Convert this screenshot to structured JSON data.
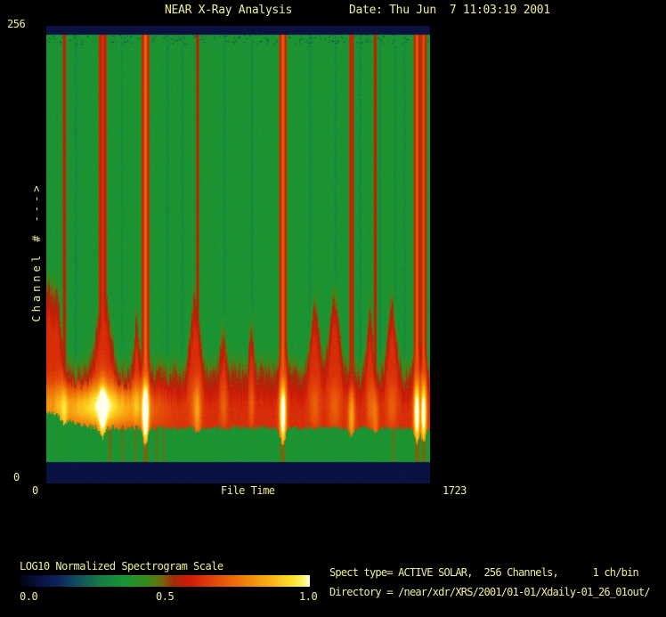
{
  "window": {
    "bg": "#000000",
    "text_color": "#f0ee9c"
  },
  "header": {
    "title": "NEAR X-Ray Analysis",
    "date": "Date: Thu Jun  7 11:03:19 2001"
  },
  "axes": {
    "y_label": "Channel # --->",
    "y_max": "256",
    "y_min": "0",
    "x_label": "File Time",
    "x_min": "0",
    "x_max": "1723"
  },
  "colorbar": {
    "label": "LOG10 Normalized Spectrogram Scale",
    "ticks": [
      "0.0",
      "0.5",
      "1.0"
    ]
  },
  "info": {
    "spect_line": "Spect type= ACTIVE SOLAR,  256 Channels,      1 ch/bin",
    "directory_line": "Directory = /near/xdr/XRS/2001/01-01/Xdaily-01_26_01out/"
  },
  "chart_data": {
    "type": "heatmap",
    "title": "NEAR X-Ray Analysis",
    "xlabel": "File Time",
    "ylabel": "Channel #",
    "x_range": [
      0,
      1723
    ],
    "y_range": [
      0,
      256
    ],
    "channels": 256,
    "ch_per_bin": 1,
    "spect_type": "ACTIVE SOLAR",
    "scale": {
      "label": "LOG10 Normalized Spectrogram Scale",
      "range": [
        0.0,
        1.0
      ],
      "ticks": [
        0.0,
        0.5,
        1.0
      ]
    },
    "colormap_stops": [
      [
        0.0,
        [
          2,
          2,
          18
        ]
      ],
      [
        0.07,
        [
          10,
          18,
          66
        ]
      ],
      [
        0.13,
        [
          14,
          36,
          92
        ]
      ],
      [
        0.2,
        [
          18,
          80,
          95
        ]
      ],
      [
        0.28,
        [
          22,
          125,
          70
        ]
      ],
      [
        0.36,
        [
          24,
          150,
          52
        ]
      ],
      [
        0.44,
        [
          55,
          140,
          30
        ]
      ],
      [
        0.49,
        [
          115,
          105,
          12
        ]
      ],
      [
        0.53,
        [
          160,
          45,
          10
        ]
      ],
      [
        0.58,
        [
          205,
          25,
          8
        ]
      ],
      [
        0.66,
        [
          225,
          65,
          8
        ]
      ],
      [
        0.76,
        [
          240,
          120,
          10
        ]
      ],
      [
        0.86,
        [
          250,
          175,
          20
        ]
      ],
      [
        0.94,
        [
          255,
          225,
          45
        ]
      ],
      [
        0.985,
        [
          255,
          248,
          120
        ]
      ],
      [
        1.0,
        [
          255,
          255,
          235
        ]
      ]
    ],
    "background_value": 0.368,
    "navy_value": 0.07,
    "bands": {
      "top_navy_from_channel": 251.5,
      "bottom_navy_to_channel": 11.5,
      "lower_green_top_channel": 31,
      "left_rise": {
        "amp": 8,
        "sigma": 0.05
      }
    },
    "flame": {
      "base_channel": 56,
      "fade_channels": 20,
      "core": {
        "center_channel": 43,
        "sigma": 9,
        "streak_center_channel": 38,
        "streak_sigma": 13,
        "left_zone": {
          "center_t": 0.14,
          "sigma": 0.09,
          "amp": 0.32
        }
      },
      "peaks": [
        {
          "t": 0.002,
          "h": 46,
          "w": 0.012
        },
        {
          "t": 0.028,
          "h": 38,
          "w": 0.01
        },
        {
          "t": 0.148,
          "h": 46,
          "w": 0.016
        },
        {
          "t": 0.235,
          "h": 28,
          "w": 0.006
        },
        {
          "t": 0.258,
          "h": 52,
          "w": 0.005
        },
        {
          "t": 0.388,
          "h": 42,
          "w": 0.011
        },
        {
          "t": 0.462,
          "h": 24,
          "w": 0.007
        },
        {
          "t": 0.535,
          "h": 28,
          "w": 0.005
        },
        {
          "t": 0.617,
          "h": 50,
          "w": 0.006
        },
        {
          "t": 0.7,
          "h": 40,
          "w": 0.01
        },
        {
          "t": 0.752,
          "h": 42,
          "w": 0.012
        },
        {
          "t": 0.844,
          "h": 36,
          "w": 0.006
        },
        {
          "t": 0.902,
          "h": 40,
          "w": 0.01
        },
        {
          "t": 0.967,
          "h": 48,
          "w": 0.005
        },
        {
          "t": 0.985,
          "h": 44,
          "w": 0.004
        }
      ]
    },
    "bursts": [
      {
        "t": 0.046,
        "file_time": 79,
        "strength": 0.32,
        "width": 1.2
      },
      {
        "t": 0.146,
        "file_time": 252,
        "strength": 0.55,
        "width": 2.4
      },
      {
        "t": 0.258,
        "file_time": 445,
        "strength": 1.0,
        "width": 2.0
      },
      {
        "t": 0.394,
        "file_time": 679,
        "strength": 0.3,
        "width": 1.2
      },
      {
        "t": 0.617,
        "file_time": 1063,
        "strength": 0.95,
        "width": 1.9
      },
      {
        "t": 0.796,
        "file_time": 1371,
        "strength": 0.5,
        "width": 1.4
      },
      {
        "t": 0.858,
        "file_time": 1478,
        "strength": 0.3,
        "width": 1.1
      },
      {
        "t": 0.967,
        "file_time": 1666,
        "strength": 0.9,
        "width": 1.8
      },
      {
        "t": 0.984,
        "file_time": 1696,
        "strength": 0.85,
        "width": 1.6
      }
    ],
    "dark_streaks": [
      0.077,
      0.197,
      0.316,
      0.355,
      0.464,
      0.536,
      0.689,
      0.754,
      0.819,
      0.87,
      0.91,
      0.935
    ],
    "bottom_dark_lines": [
      0.165,
      0.199,
      0.232,
      0.288,
      0.305,
      0.62,
      0.905
    ]
  }
}
